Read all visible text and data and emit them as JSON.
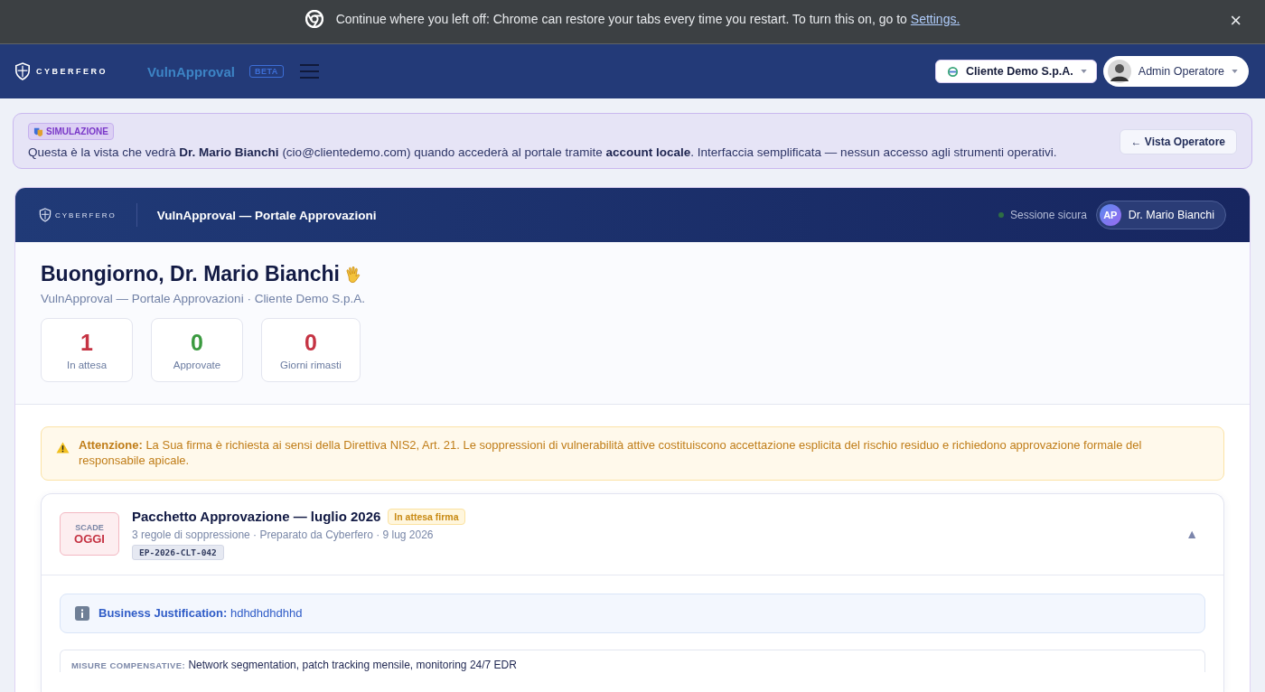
{
  "infobar": {
    "message": "Continue where you left off: Chrome can restore your tabs every time you restart. To turn this on, go to",
    "link": "Settings.",
    "close": "×"
  },
  "topbar": {
    "brand": "CYBERFERO",
    "app_name": "VulnApproval",
    "badge": "BETA",
    "client": "Cliente Demo S.p.A.",
    "user": "Admin Operatore"
  },
  "simulation": {
    "badge": "SIMULAZIONE",
    "text": "Questa è la vista che vedrà **Dr. Mario Bianchi** (cio@clientedemo.com) quando accederà al portale tramite **account locale**. Interfaccia semplificata — nessun accesso agli strumenti operativi.",
    "button": "← Vista Operatore"
  },
  "portal": {
    "brand": "CYBERFERO",
    "title": "VulnApproval — Portale Approvazioni",
    "session": "Sessione sicura",
    "avatar": "AP",
    "user": "Dr. Mario Bianchi",
    "greeting": "Buongiorno, Dr. Mario Bianchi",
    "subtitle": "VulnApproval — Portale Approvazioni · Cliente Demo S.p.A.",
    "stats": [
      {
        "value": "1",
        "label": "In attesa",
        "color": "#c53343"
      },
      {
        "value": "0",
        "label": "Approvate",
        "color": "#3a9a3f"
      },
      {
        "value": "0",
        "label": "Giorni rimasti",
        "color": "#c53343"
      }
    ],
    "warning": {
      "lead": "Attenzione:",
      "text": "La Sua firma è richiesta ai sensi della Direttiva NIS2, Art. 21. Le soppressioni di vulnerabilità attive costituiscono accettazione esplicita del rischio residuo e richiedono approvazione formale del responsabile apicale."
    },
    "package": {
      "due_top": "SCADE",
      "due_bottom": "OGGI",
      "title": "Pacchetto Approvazione — luglio 2026",
      "status": "In attesa firma",
      "meta": "3 regole di soppressione · Preparato da Cyberfero · 9 lug 2026",
      "code": "EP-2026-CLT-042",
      "toggle": "▲",
      "justification_label": "Business Justification:",
      "justification": "hdhdhdhdhhd",
      "measures_label": "MISURE COMPENSATIVE:",
      "measures": "Network segmentation, patch tracking mensile, monitoring 24/7 EDR"
    }
  }
}
